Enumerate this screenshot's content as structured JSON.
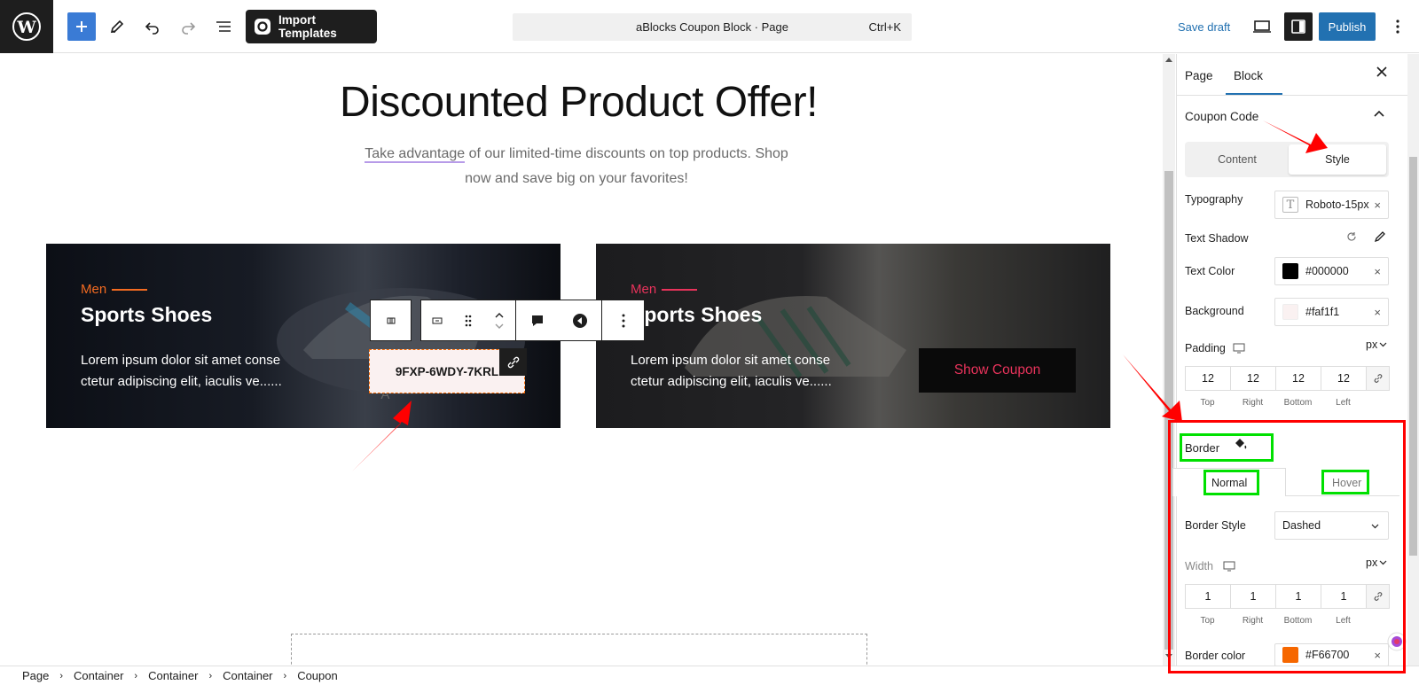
{
  "toolbar": {
    "import_label": "Import Templates",
    "command_title": "aBlocks Coupon Block · Page",
    "command_shortcut": "Ctrl+K",
    "save_draft": "Save draft",
    "publish": "Publish"
  },
  "canvas": {
    "headline": "Discounted Product Offer!",
    "sub_highlight": "Take advantage",
    "sub_rest": " of our limited-time discounts on top products. Shop now and save big on your favorites!",
    "cards": [
      {
        "category": "Men",
        "title": "Sports Shoes",
        "text": "Lorem ipsum dolor sit amet conse ctetur adipiscing elit, iaculis ve......",
        "coupon": "9FXP-6WDY-7KRL"
      },
      {
        "category": "Men",
        "title": "Sports Shoes",
        "text": "Lorem ipsum dolor sit amet conse ctetur adipiscing elit, iaculis ve......",
        "button": "Show Coupon"
      }
    ],
    "partial_text": "\"A"
  },
  "sidebar": {
    "tabs": [
      "Page",
      "Block"
    ],
    "section": "Coupon Code",
    "subtabs": [
      "Content",
      "Style"
    ],
    "typography_label": "Typography",
    "typography_value": "Roboto-15px",
    "text_shadow_label": "Text Shadow",
    "text_color_label": "Text Color",
    "text_color_value": "#000000",
    "background_label": "Background",
    "background_value": "#faf1f1",
    "padding_label": "Padding",
    "padding_unit": "px",
    "padding": {
      "top": "12",
      "right": "12",
      "bottom": "12",
      "left": "12"
    },
    "side_labels": [
      "Top",
      "Right",
      "Bottom",
      "Left"
    ],
    "border_label": "Border",
    "border_tabs": [
      "Normal",
      "Hover"
    ],
    "border_style_label": "Border Style",
    "border_style_value": "Dashed",
    "width_label": "Width",
    "width_unit": "px",
    "width": {
      "top": "1",
      "right": "1",
      "bottom": "1",
      "left": "1"
    },
    "border_color_label": "Border color",
    "border_color_value": "#F66700"
  },
  "breadcrumb": [
    "Page",
    "Container",
    "Container",
    "Container",
    "Coupon"
  ],
  "colors": {
    "accent": "#2271b1",
    "men_card1": "#f36b21",
    "men_card2": "#e8335b",
    "annotation_red": "#ff0000",
    "annotation_green": "#00e000"
  }
}
